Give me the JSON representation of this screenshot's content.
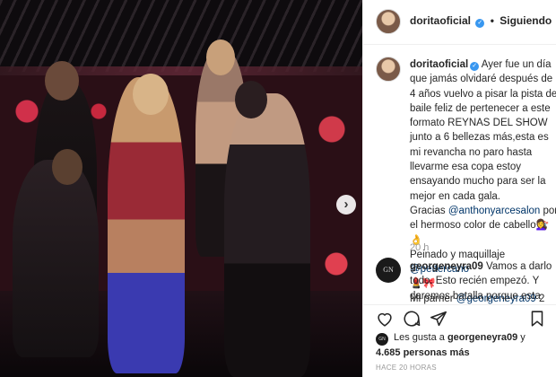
{
  "post": {
    "username": "doritaoficial",
    "separator": "•",
    "follow_status": "Siguiendo",
    "caption_author": "doritaoficial",
    "caption_part1": "Ayer fue un día que jamás olvidaré después de 4 años vuelvo a pisar la pista de baile feliz de pertenecer a este formato REYNAS DEL SHOW junto a 6 bellezas más,esta es mi revancha no paro hasta llevarme esa copa estoy ensayando mucho para ser la mejor en cada gala.\nGracias ",
    "mention1": "@anthonyarcesalon",
    "caption_part2": " por el hermoso color de cabello💇‍♀️👌\nPeinado y maquillaje ",
    "mention2": "@pettercano",
    "caption_part3": "\n💄🎀\nMi parner ",
    "mention3": "@georgeneyra09",
    "caption_part4": " 2 veces campeón del mundo 👏👏👏👏",
    "time_short": "20 h"
  },
  "comment": {
    "avatar_text": "GN",
    "author": "georgeneyra09",
    "text": " Vamos a darlo todo. Esto recién empezó. Y daremos batalla porque esta"
  },
  "likes": {
    "prefix": "Les gusta a ",
    "first_user": "georgeneyra09",
    "suffix": " y",
    "count": "4.685 personas más"
  },
  "posted_ago": "HACE 20 HORAS",
  "icons": {
    "carousel_next": "›",
    "verified": "✓",
    "actions": [
      "heart-icon",
      "comment-icon",
      "share-icon",
      "bookmark-icon"
    ]
  },
  "colors": {
    "link": "#003569",
    "verified": "#3897f0",
    "muted": "#999999"
  }
}
